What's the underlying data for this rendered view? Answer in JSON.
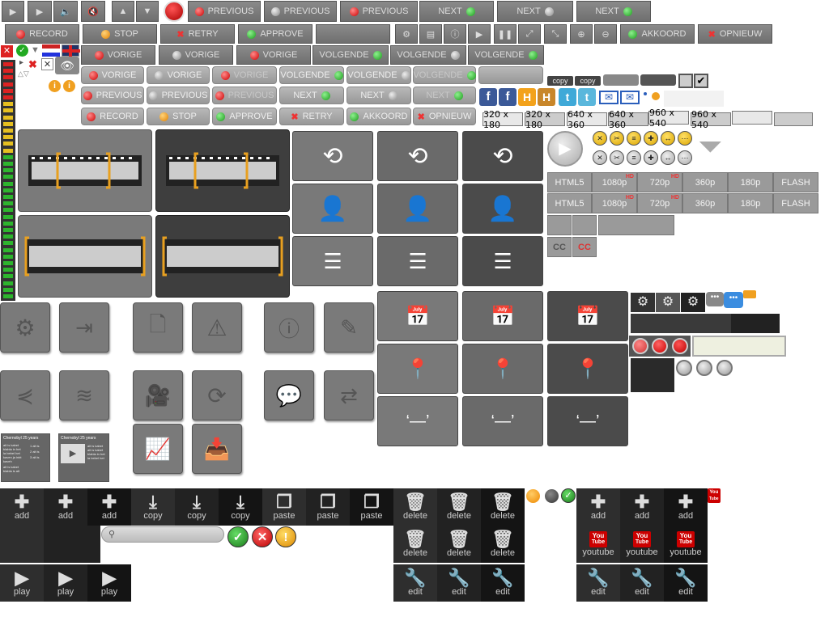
{
  "top_row1": {
    "prev_labels": [
      "PREVIOUS",
      "PREVIOUS",
      "PREVIOUS"
    ],
    "next_labels": [
      "NEXT",
      "NEXT",
      "NEXT"
    ]
  },
  "top_row2": {
    "record": "RECORD",
    "stop": "STOP",
    "retry": "RETRY",
    "approve": "APPROVE",
    "akkoord": "AKKOORD",
    "opnieuw": "OPNIEUW"
  },
  "top_row3": {
    "prev_labels": [
      "VORIGE",
      "VORIGE",
      "VORIGE"
    ],
    "next_labels": [
      "VOLGENDE",
      "VOLGENDE",
      "VOLGENDE"
    ]
  },
  "light_rows": {
    "row1": [
      "VORIGE",
      "VORIGE",
      "VORIGE",
      "VOLGENDE",
      "VOLGENDE",
      "VOLGENDE"
    ],
    "row2": [
      "PREVIOUS",
      "PREVIOUS",
      "PREVIOUS",
      "NEXT",
      "NEXT",
      "NEXT"
    ],
    "row3": [
      "RECORD",
      "STOP",
      "APPROVE",
      "RETRY",
      "AKKOORD",
      "OPNIEUW"
    ]
  },
  "copy_labels": [
    "copy",
    "copy"
  ],
  "resolutions": [
    "320 x 180",
    "320 x 180",
    "640 x 360",
    "640 x 360",
    "960 x 540",
    "960 x 540"
  ],
  "video_quality": {
    "row": [
      "HTML5",
      "1080p",
      "720p",
      "360p",
      "180p",
      "FLASH"
    ],
    "hd": "HD",
    "cc": "CC"
  },
  "thumbnails": {
    "title": "Chernobyl 25 years",
    "lines": [
      "alt is kabet",
      "blabla in het",
      "la bebel het",
      "kaven ja inbt",
      "kaveh",
      "alt is kabet",
      "blabla is alt"
    ],
    "links": [
      "1 alt is",
      "2 alt is",
      "3 alt is"
    ]
  },
  "toolbar": {
    "add": "add",
    "copy": "copy",
    "paste": "paste",
    "delete": "delete",
    "play": "play",
    "edit": "edit",
    "youtube": "youtube",
    "yt_logo_top": "You",
    "yt_logo_bottom": "Tube"
  },
  "colors": {
    "accent_red": "#dd2222",
    "accent_green": "#22aa22",
    "accent_orange": "#f0a020",
    "dark_tile": "#4b4b4b"
  }
}
